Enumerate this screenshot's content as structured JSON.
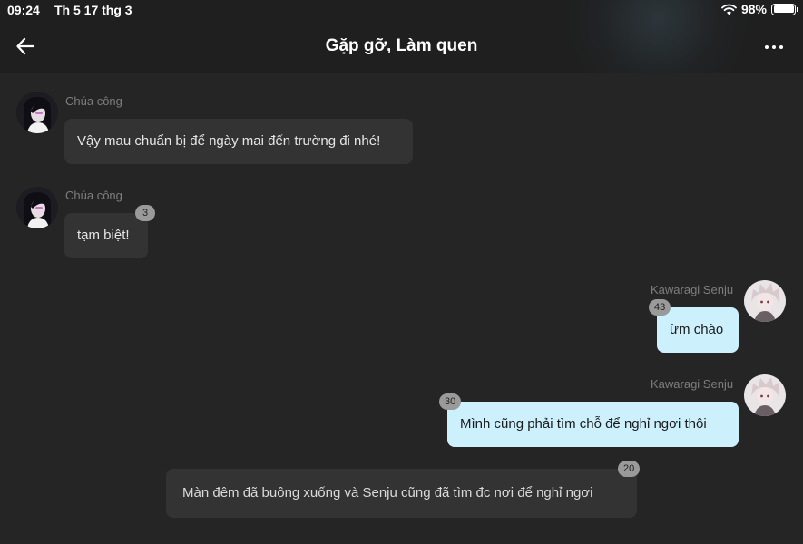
{
  "status_bar": {
    "time": "09:24",
    "date": "Th 5 17 thg 3",
    "battery": "98%",
    "wifi_icon": "wifi-icon",
    "battery_icon": "battery-icon"
  },
  "header": {
    "title": "Gặp gỡ, Làm quen",
    "back_icon": "arrow-left-icon",
    "more_icon": "ellipsis-icon"
  },
  "colors": {
    "background": "#252525",
    "bubble_dark": "#333333",
    "bubble_light": "#cdf0fd",
    "badge": "#9a9a9a",
    "name_text": "#7d7d7d"
  },
  "messages": [
    {
      "sender": "Chúa công",
      "text": "Vậy mau chuẩn bị để ngày mai đến trường đi nhé!",
      "side": "left"
    },
    {
      "sender": "Chúa công",
      "text": "tạm biệt!",
      "side": "left",
      "badge": "3"
    },
    {
      "sender": "Kawaragi Senju",
      "text": "ừm chào",
      "side": "right",
      "badge": "43"
    },
    {
      "sender": "Kawaragi Senju",
      "text": "Mình cũng phải tìm chỗ để nghỉ ngơi thôi",
      "side": "right",
      "badge": "30"
    },
    {
      "text": "Màn đêm đã buông xuống và Senju cũng đã tìm đc nơi để nghỉ ngơi",
      "side": "narration",
      "badge": "20"
    }
  ]
}
